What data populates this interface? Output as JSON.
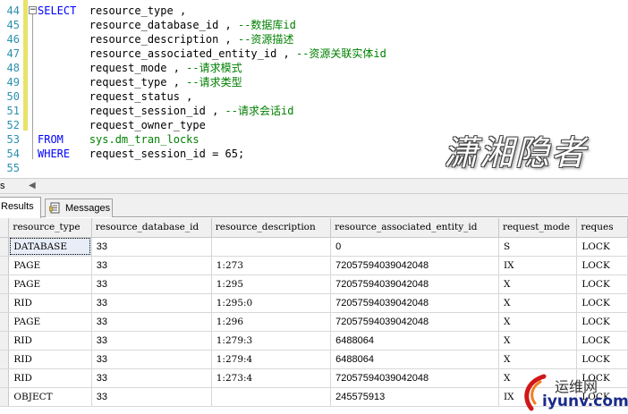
{
  "editor": {
    "lines": [
      {
        "n": "44",
        "parts": [
          {
            "t": "SELECT",
            "c": "kw"
          },
          {
            "t": "  resource_type ,",
            "c": ""
          }
        ]
      },
      {
        "n": "45",
        "parts": [
          {
            "t": "        resource_database_id , ",
            "c": ""
          },
          {
            "t": "--数据库id",
            "c": "cm"
          }
        ]
      },
      {
        "n": "46",
        "parts": [
          {
            "t": "        resource_description , ",
            "c": ""
          },
          {
            "t": "--资源描述",
            "c": "cm"
          }
        ]
      },
      {
        "n": "47",
        "parts": [
          {
            "t": "        resource_associated_entity_id , ",
            "c": ""
          },
          {
            "t": "--资源关联实体id",
            "c": "cm"
          }
        ]
      },
      {
        "n": "48",
        "parts": [
          {
            "t": "        request_mode , ",
            "c": ""
          },
          {
            "t": "--请求模式",
            "c": "cm"
          }
        ]
      },
      {
        "n": "49",
        "parts": [
          {
            "t": "        request_type , ",
            "c": ""
          },
          {
            "t": "--请求类型",
            "c": "cm"
          }
        ]
      },
      {
        "n": "50",
        "parts": [
          {
            "t": "        request_status ,",
            "c": ""
          }
        ]
      },
      {
        "n": "51",
        "parts": [
          {
            "t": "        request_session_id , ",
            "c": ""
          },
          {
            "t": "--请求会话id",
            "c": "cm"
          }
        ]
      },
      {
        "n": "52",
        "parts": [
          {
            "t": "        request_owner_type",
            "c": ""
          }
        ]
      },
      {
        "n": "53",
        "parts": [
          {
            "t": "FROM",
            "c": "kw"
          },
          {
            "t": "    ",
            "c": ""
          },
          {
            "t": "sys.dm_tran_locks",
            "c": "sys"
          }
        ]
      },
      {
        "n": "54",
        "parts": [
          {
            "t": "WHERE",
            "c": "kw"
          },
          {
            "t": "   request_session_id = 65;",
            "c": ""
          }
        ]
      },
      {
        "n": "55",
        "parts": []
      }
    ],
    "fold_symbol": "−",
    "watermark": "潇湘隐者"
  },
  "status": {
    "zoom_fragment": "s",
    "scroll_left_arrow": "◀"
  },
  "tabs": {
    "results": "Results",
    "messages": "Messages"
  },
  "grid": {
    "columns": [
      "resource_type",
      "resource_database_id",
      "resource_description",
      "resource_associated_entity_id",
      "request_mode",
      "reques"
    ],
    "rows": [
      [
        "DATABASE",
        "33",
        "",
        "0",
        "S",
        "LOCK"
      ],
      [
        "PAGE",
        "33",
        "1:273",
        "72057594039042048",
        "IX",
        "LOCK"
      ],
      [
        "PAGE",
        "33",
        "1:295",
        "72057594039042048",
        "X",
        "LOCK"
      ],
      [
        "RID",
        "33",
        "1:295:0",
        "72057594039042048",
        "X",
        "LOCK"
      ],
      [
        "PAGE",
        "33",
        "1:296",
        "72057594039042048",
        "X",
        "LOCK"
      ],
      [
        "RID",
        "33",
        "1:279:3",
        "6488064",
        "X",
        "LOCK"
      ],
      [
        "RID",
        "33",
        "1:279:4",
        "6488064",
        "X",
        "LOCK"
      ],
      [
        "RID",
        "33",
        "1:273:4",
        "72057594039042048",
        "X",
        "LOCK"
      ],
      [
        "OBJECT",
        "33",
        "",
        "245575913",
        "IX",
        "LOCK"
      ]
    ]
  },
  "logo": {
    "text": "运维网",
    "url": "iyunv.com"
  }
}
